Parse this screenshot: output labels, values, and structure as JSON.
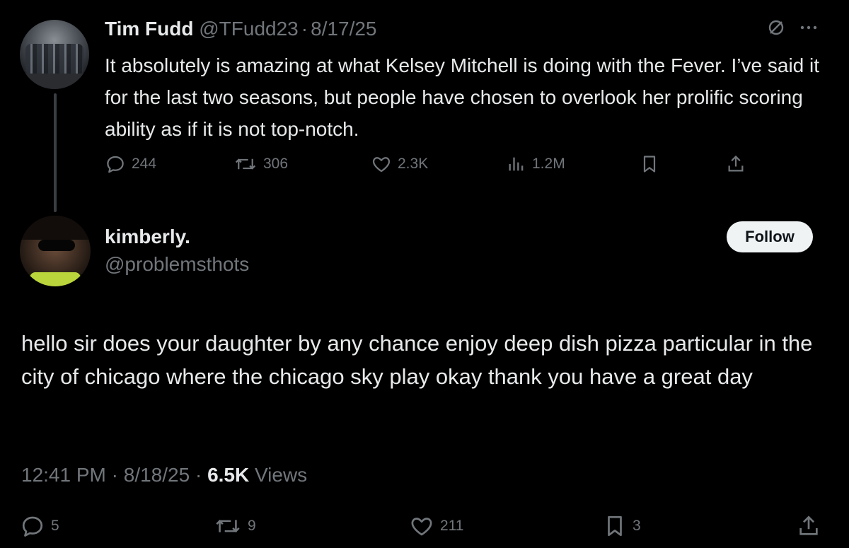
{
  "parent": {
    "name": "Tim Fudd",
    "handle": "@TFudd23",
    "separator": "·",
    "date": "8/17/25",
    "text": "It absolutely is amazing at what Kelsey Mitchell is doing with the Fever. I’ve said it for the last two seasons, but people have chosen to overlook her prolific scoring ability as if it is not top-notch.",
    "replies": "244",
    "reposts": "306",
    "likes": "2.3K",
    "views": "1.2M"
  },
  "reply": {
    "name": "kimberly.",
    "handle": "@problemsthots",
    "follow_label": "Follow",
    "text": "hello sir does your daughter by any chance enjoy deep dish pizza particular in the city of chicago where the chicago sky play okay thank you have a great day",
    "time": "12:41 PM",
    "separator": "·",
    "date": "8/18/25",
    "views_count": "6.5K",
    "views_label": "Views",
    "replies": "5",
    "reposts": "9",
    "likes": "211",
    "bookmarks": "3"
  },
  "icons": {
    "top_right": [
      "muted-circle-slash-icon",
      "more-icon"
    ],
    "actions": [
      "reply-icon",
      "repost-icon",
      "like-icon",
      "views-icon",
      "bookmark-icon",
      "share-icon"
    ]
  },
  "colors": {
    "background": "#000000",
    "text": "#e7e9ea",
    "muted": "#71767b",
    "follow_bg": "#eff3f4"
  }
}
